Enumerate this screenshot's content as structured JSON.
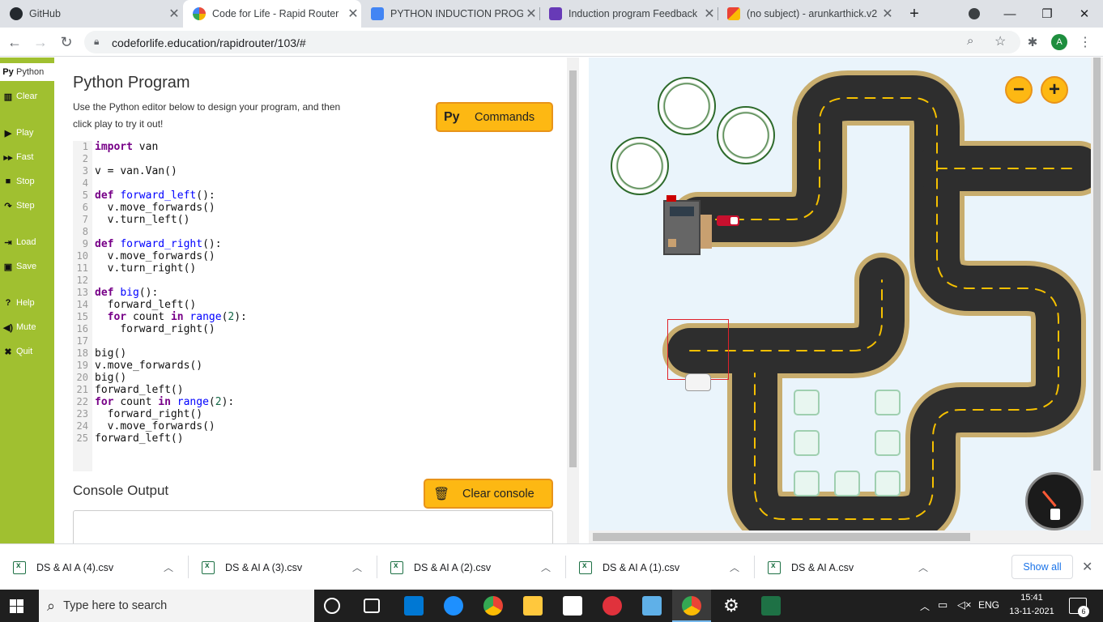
{
  "browser": {
    "tabs": [
      {
        "title": "GitHub",
        "color": "#24292e"
      },
      {
        "title": "Code for Life - Rapid Router",
        "color": "#e84d3d",
        "active": true
      },
      {
        "title": "PYTHON INDUCTION PROGR",
        "color": "#4285f4"
      },
      {
        "title": "Induction program Feedback",
        "color": "#673ab7"
      },
      {
        "title": "(no subject) - arunkarthick.v2",
        "color": "#ea4335"
      }
    ],
    "new_tab": "+",
    "url": "codeforlife.education/rapidrouter/103/#",
    "profile_initial": "A"
  },
  "sidebar": {
    "items": [
      {
        "icon": "Py",
        "label": "Python"
      },
      {
        "icon": "▥",
        "label": "Clear"
      },
      {
        "icon": "▶",
        "label": "Play"
      },
      {
        "icon": "▸▸",
        "label": "Fast"
      },
      {
        "icon": "■",
        "label": "Stop"
      },
      {
        "icon": "↷",
        "label": "Step"
      },
      {
        "icon": "⇥",
        "label": "Load"
      },
      {
        "icon": "▣",
        "label": "Save"
      },
      {
        "icon": "?",
        "label": "Help"
      },
      {
        "icon": "◀)",
        "label": "Mute"
      },
      {
        "icon": "✖",
        "label": "Quit"
      }
    ]
  },
  "program": {
    "title": "Python Program",
    "description": "Use the Python editor below to design your program, and then click play to try it out!",
    "commands_icon": "Py",
    "commands_label": "Commands",
    "console_title": "Console Output",
    "clear_console_label": "Clear console",
    "code_lines": [
      "import van",
      "",
      "v = van.Van()",
      "",
      "def forward_left():",
      "  v.move_forwards()",
      "  v.turn_left()",
      "",
      "def forward_right():",
      "  v.move_forwards()",
      "  v.turn_right()",
      "",
      "def big():",
      "  forward_left()",
      "  for count in range(2):",
      "    forward_right()",
      "",
      "big()",
      "v.move_forwards()",
      "big()",
      "forward_left()",
      "for count in range(2):",
      "  forward_right()",
      "  v.move_forwards()",
      "forward_left()"
    ]
  },
  "game": {
    "zoom_out": "−",
    "zoom_in": "+"
  },
  "downloads": {
    "files": [
      "DS & AI A (4).csv",
      "DS & AI A (3).csv",
      "DS & AI A (2).csv",
      "DS & AI A (1).csv",
      "DS & AI A.csv"
    ],
    "show_all": "Show all"
  },
  "taskbar": {
    "search_placeholder": "Type here to search",
    "language": "ENG",
    "time": "15:41",
    "date": "13-11-2021",
    "notifications": "6"
  }
}
